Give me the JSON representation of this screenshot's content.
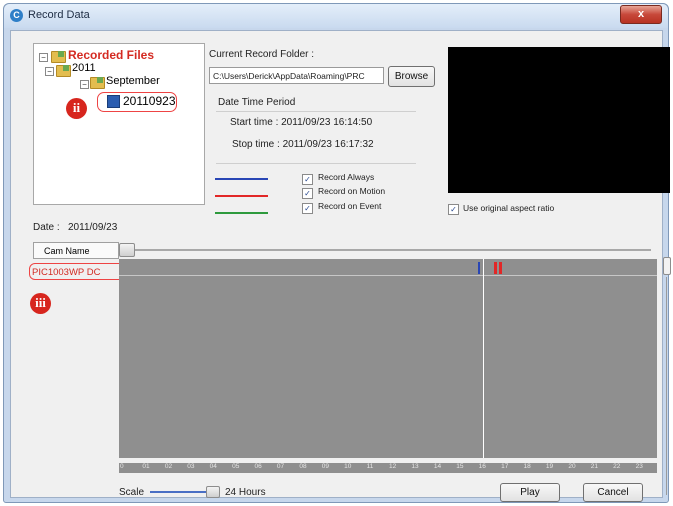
{
  "window": {
    "title": "Record Data",
    "close": "x"
  },
  "tree": {
    "root": "Recorded Files",
    "year": "2011",
    "month": "September",
    "day": "20110923",
    "callout": "ii"
  },
  "folder": {
    "label": "Current Record Folder :",
    "path": "C:\\Users\\Derick\\AppData\\Roaming\\PRC",
    "browse": "Browse"
  },
  "period": {
    "heading": "Date Time Period",
    "start": "Start time : 2011/09/23 16:14:50",
    "stop": "Stop time : 2011/09/23 16:17:32"
  },
  "legend": [
    {
      "label": "Record Always",
      "color": "#2946b5",
      "checked": true
    },
    {
      "label": "Record on Motion",
      "color": "#e22727",
      "checked": true
    },
    {
      "label": "Record on Event",
      "color": "#2e9a3d",
      "checked": true
    }
  ],
  "aspect": {
    "label": "Use original aspect ratio",
    "checked": true
  },
  "date": {
    "label": "Date :",
    "value": "2011/09/23"
  },
  "camera": {
    "header": "Cam Name",
    "name": "PIC1003WP DC",
    "callout": "iii"
  },
  "hours": [
    "0",
    "01",
    "02",
    "03",
    "04",
    "05",
    "06",
    "07",
    "08",
    "09",
    "10",
    "11",
    "12",
    "13",
    "14",
    "15",
    "16",
    "17",
    "18",
    "19",
    "20",
    "21",
    "22",
    "23"
  ],
  "scale": {
    "label": "Scale",
    "value": "24 Hours"
  },
  "actions": {
    "play": "Play",
    "cancel": "Cancel"
  },
  "cursor_hour": 16.25
}
